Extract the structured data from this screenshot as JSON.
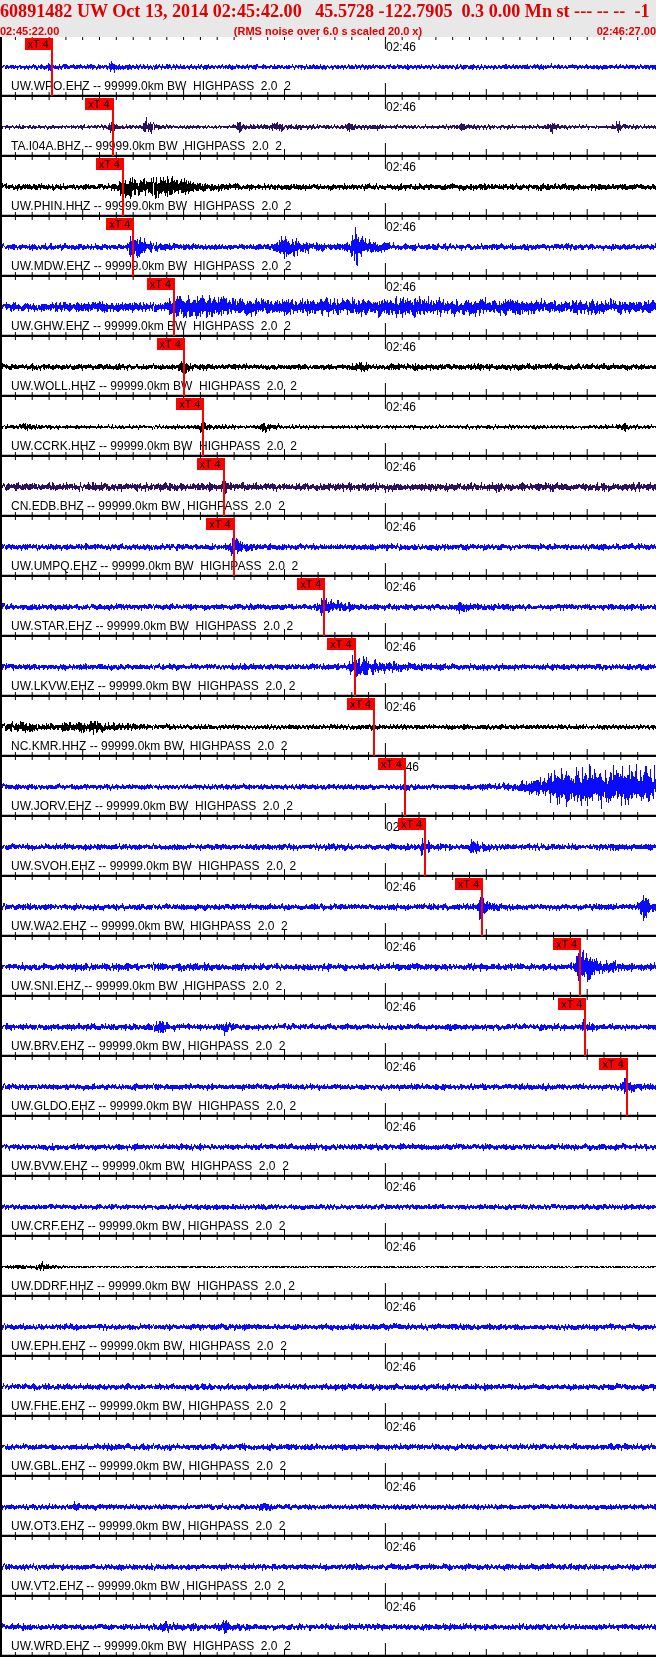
{
  "header": {
    "title": "60891482 UW Oct 13, 2014 02:45:42.00   45.5728 -122.7905  0.3 0.00 Mn st --- -- --  -1",
    "start_time": "02:45:22.00",
    "note": "(RMS noise over 6.0 s scaled 20.0 x)",
    "end_time": "02:46:27.00"
  },
  "traces": [
    {
      "label": "UW.WPO.EHZ -- 99999.0km BW  HIGHPASS  2.0  2",
      "time_label": "02:46",
      "color": "#0a0aff",
      "pick": {
        "label": "xT 4",
        "level": 0.076
      }
    },
    {
      "label": "TA.I04A.BHZ -- 99999.0km BW  HIGHPASS  2.0  2",
      "time_label": "02:46",
      "color": "#2b1260",
      "pick": {
        "label": "xT 4",
        "level": 0.169
      }
    },
    {
      "label": "UW.PHIN.HHZ -- 99999.0km BW  HIGHPASS  2.0  2",
      "time_label": "02:46",
      "color": "#000000",
      "pick": {
        "label": "xT 4",
        "level": 0.185
      }
    },
    {
      "label": "UW.MDW.EHZ -- 99999.0km BW  HIGHPASS  2.0  2",
      "time_label": "02:46",
      "color": "#0a0aff",
      "pick": {
        "label": "xT 4",
        "level": 0.201
      }
    },
    {
      "label": "UW.GHW.EHZ -- 99999.0km BW  HIGHPASS  2.0  2",
      "time_label": "02:46",
      "color": "#0a0aff",
      "pick": {
        "label": "xT 4",
        "level": 0.263
      }
    },
    {
      "label": "UW.WOLL.HHZ -- 99999.0km BW  HIGHPASS  2.0  2",
      "time_label": "02:46",
      "color": "#000000",
      "pick": {
        "label": "xT 4",
        "level": 0.278
      }
    },
    {
      "label": "UW.CCRK.HHZ -- 99999.0km BW  HIGHPASS  2.0  2",
      "time_label": "02:46",
      "color": "#000000",
      "pick": {
        "label": "xT 4",
        "level": 0.308
      }
    },
    {
      "label": "CN.EDB.BHZ -- 99999.0km BW  HIGHPASS  2.0  2",
      "time_label": "02:46",
      "color": "#2b1260",
      "pick": {
        "label": "xT 4",
        "level": 0.339
      }
    },
    {
      "label": "UW.UMPQ.EHZ -- 99999.0km BW  HIGHPASS  2.0  2",
      "time_label": "02:46",
      "color": "#0a0aff",
      "pick": {
        "label": "xT 4",
        "level": 0.354
      }
    },
    {
      "label": "UW.STAR.EHZ -- 99999.0km BW  HIGHPASS  2.0  2",
      "time_label": "02:46",
      "color": "#0a0aff",
      "pick": {
        "label": "xT 4",
        "level": 0.493
      }
    },
    {
      "label": "UW.LKVW.EHZ -- 99999.0km BW  HIGHPASS  2.0  2",
      "time_label": "02:46",
      "color": "#0a0aff",
      "pick": {
        "label": "xT 4",
        "level": 0.539
      }
    },
    {
      "label": "NC.KMR.HHZ -- 99999.0km BW  HIGHPASS  2.0  2",
      "time_label": "02:46",
      "color": "#000000",
      "pick": {
        "label": "xT 4",
        "level": 0.569
      }
    },
    {
      "label": "UW.JORV.EHZ -- 99999.0km BW  HIGHPASS  2.0  2",
      "time_label": "46",
      "color": "#0a0aff",
      "pick": {
        "label": "xT 4",
        "level": 0.616
      }
    },
    {
      "label": "UW.SVOH.EHZ -- 99999.0km BW  HIGHPASS  2.0  2",
      "time_label": "02",
      "color": "#0a0aff",
      "pick": {
        "label": "xT 4",
        "level": 0.647
      }
    },
    {
      "label": "UW.WA2.EHZ -- 99999.0km BW  HIGHPASS  2.0  2",
      "time_label": "02:46",
      "color": "#0a0aff",
      "pick": {
        "label": "xT 4",
        "level": 0.734
      }
    },
    {
      "label": "UW.SNI.EHZ -- 99999.0km BW  HIGHPASS  2.0  2",
      "time_label": "02:46",
      "color": "#0a0aff",
      "pick": {
        "label": "xT 4",
        "level": 0.884
      }
    },
    {
      "label": "UW.BRV.EHZ -- 99999.0km BW  HIGHPASS  2.0  2",
      "time_label": "02:46",
      "color": "#0a0aff",
      "pick": {
        "label": "xT 4",
        "level": 0.892
      }
    },
    {
      "label": "UW.GLDO.EHZ -- 99999.0km BW  HIGHPASS  2.0  2",
      "time_label": "02:46",
      "color": "#0a0aff",
      "pick": {
        "label": "xT 4",
        "level": 0.955
      }
    },
    {
      "label": "UW.BVW.EHZ -- 99999.0km BW  HIGHPASS  2.0  2",
      "time_label": "02:46",
      "color": "#0a0aff"
    },
    {
      "label": "UW.CRF.EHZ -- 99999.0km BW  HIGHPASS  2.0  2",
      "time_label": "02:46",
      "color": "#0a0aff"
    },
    {
      "label": "UW.DDRF.HHZ -- 99999.0km BW  HIGHPASS  2.0  2",
      "time_label": "02:46",
      "color": "#000000"
    },
    {
      "label": "UW.EPH.EHZ -- 99999.0km BW  HIGHPASS  2.0  2",
      "time_label": "02:46",
      "color": "#0a0aff"
    },
    {
      "label": "UW.FHE.EHZ -- 99999.0km BW  HIGHPASS  2.0  2",
      "time_label": "02:46",
      "color": "#0a0aff"
    },
    {
      "label": "UW.GBL.EHZ -- 99999.0km BW  HIGHPASS  2.0  2",
      "time_label": "02:46",
      "color": "#0a0aff"
    },
    {
      "label": "UW.OT3.EHZ -- 99999.0km BW  HIGHPASS  2.0  2",
      "time_label": "02:46",
      "color": "#0a0aff"
    },
    {
      "label": "UW.VT2.EHZ -- 99999.0km BW  HIGHPASS  2.0  2",
      "time_label": "02:46",
      "color": "#0a0aff"
    },
    {
      "label": "UW.WRD.EHZ -- 99999.0km BW  HIGHPASS  2.0  2",
      "time_label": "02:46",
      "color": "#0a0aff"
    }
  ]
}
